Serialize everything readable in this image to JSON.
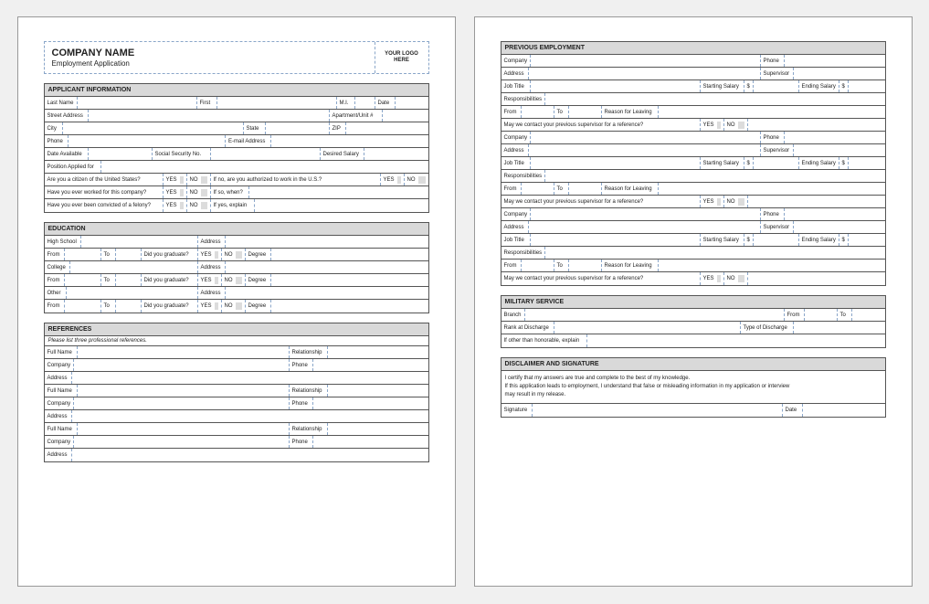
{
  "header": {
    "company": "COMPANY NAME",
    "subtitle": "Employment Application",
    "logo": "YOUR LOGO HERE"
  },
  "labels": {
    "yes": "YES",
    "no": "NO"
  },
  "applicant": {
    "section": "APPLICANT INFORMATION",
    "lastName": "Last Name",
    "first": "First",
    "mi": "M.I.",
    "date": "Date",
    "street": "Street Address",
    "apt": "Apartment/Unit #",
    "city": "City",
    "state": "State",
    "zip": "ZIP",
    "phone": "Phone",
    "email": "E-mail Address",
    "dateAvail": "Date Available",
    "ssn": "Social Security No.",
    "desiredSalary": "Desired Salary",
    "position": "Position Applied for",
    "citizen": "Are you a citizen of the United States?",
    "authorized": "If no, are you authorized to work in the U.S.?",
    "worked": "Have you ever worked for this company?",
    "when": "If so, when?",
    "felony": "Have you ever been convicted of a felony?",
    "explain": "If yes, explain"
  },
  "education": {
    "section": "EDUCATION",
    "highSchool": "High School",
    "college": "College",
    "other": "Other",
    "address": "Address",
    "from": "From",
    "to": "To",
    "graduate": "Did you graduate?",
    "degree": "Degree"
  },
  "references": {
    "section": "REFERENCES",
    "note": "Please list three professional references.",
    "fullName": "Full Name",
    "relationship": "Relationship",
    "company": "Company",
    "phone": "Phone",
    "address": "Address"
  },
  "employment": {
    "section": "PREVIOUS EMPLOYMENT",
    "company": "Company",
    "phone": "Phone",
    "address": "Address",
    "supervisor": "Supervisor",
    "jobTitle": "Job Title",
    "startSalary": "Starting Salary",
    "endSalary": "Ending Salary",
    "dollar": "$",
    "responsibilities": "Responsibilities",
    "from": "From",
    "to": "To",
    "reason": "Reason for Leaving",
    "contactRef": "May we contact your previous supervisor for a reference?"
  },
  "military": {
    "section": "MILITARY SERVICE",
    "branch": "Branch",
    "from": "From",
    "to": "To",
    "rank": "Rank at Discharge",
    "type": "Type of Discharge",
    "otherThan": "If other than honorable, explain"
  },
  "disclaimer": {
    "section": "DISCLAIMER AND SIGNATURE",
    "l1": "I certify that my answers are true and complete to the best of my knowledge.",
    "l2": "If this application leads to employment, I understand that false or misleading information in my application or interview",
    "l3": "may result in my release.",
    "signature": "Signature",
    "date": "Date"
  }
}
